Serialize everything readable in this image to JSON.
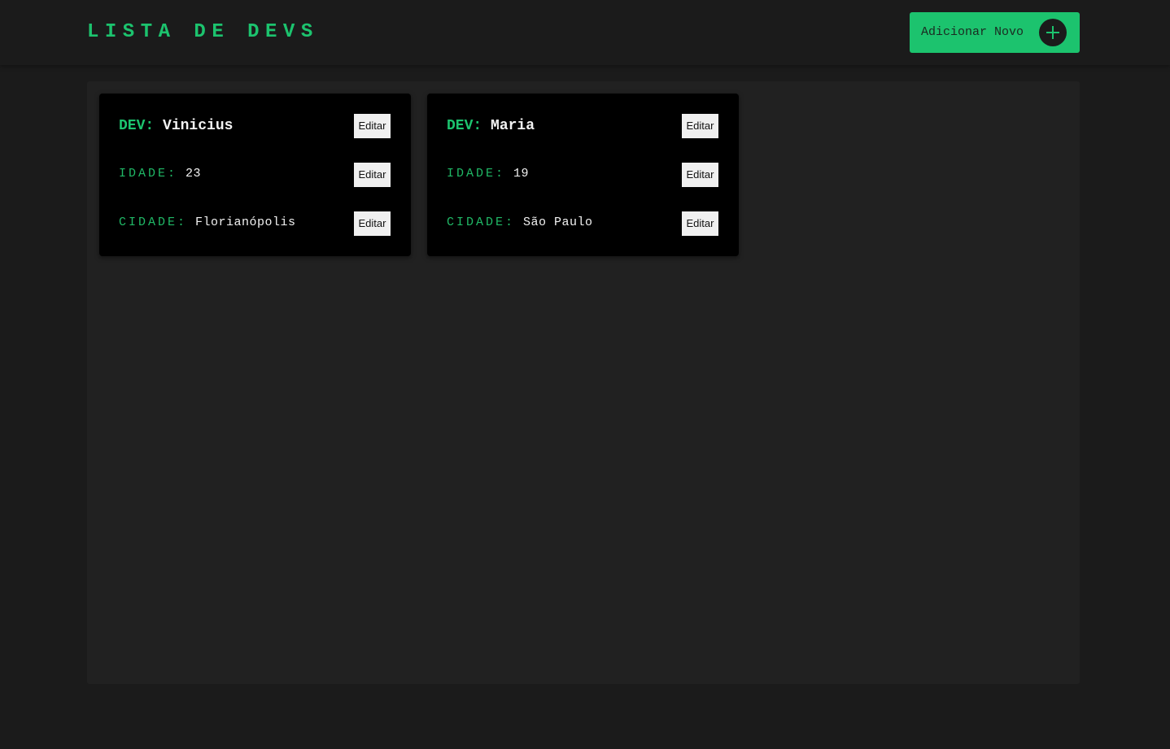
{
  "header": {
    "title": "LISTA DE DEVS",
    "add_button_label": "Adicionar Novo",
    "add_icon": "plus-icon"
  },
  "colors": {
    "accent": "#1cc36e",
    "background": "#1b1b1b",
    "panel": "#212121",
    "card": "#000000"
  },
  "devs": [
    {
      "dev_label": "DEV:",
      "name": "Vinicius",
      "idade_label": "IDADE:",
      "idade": "23",
      "cidade_label": "CIDADE:",
      "cidade": "Florianópolis",
      "edit_label": "Editar"
    },
    {
      "dev_label": "DEV:",
      "name": "Maria",
      "idade_label": "IDADE:",
      "idade": "19",
      "cidade_label": "CIDADE:",
      "cidade": "São Paulo",
      "edit_label": "Editar"
    }
  ]
}
